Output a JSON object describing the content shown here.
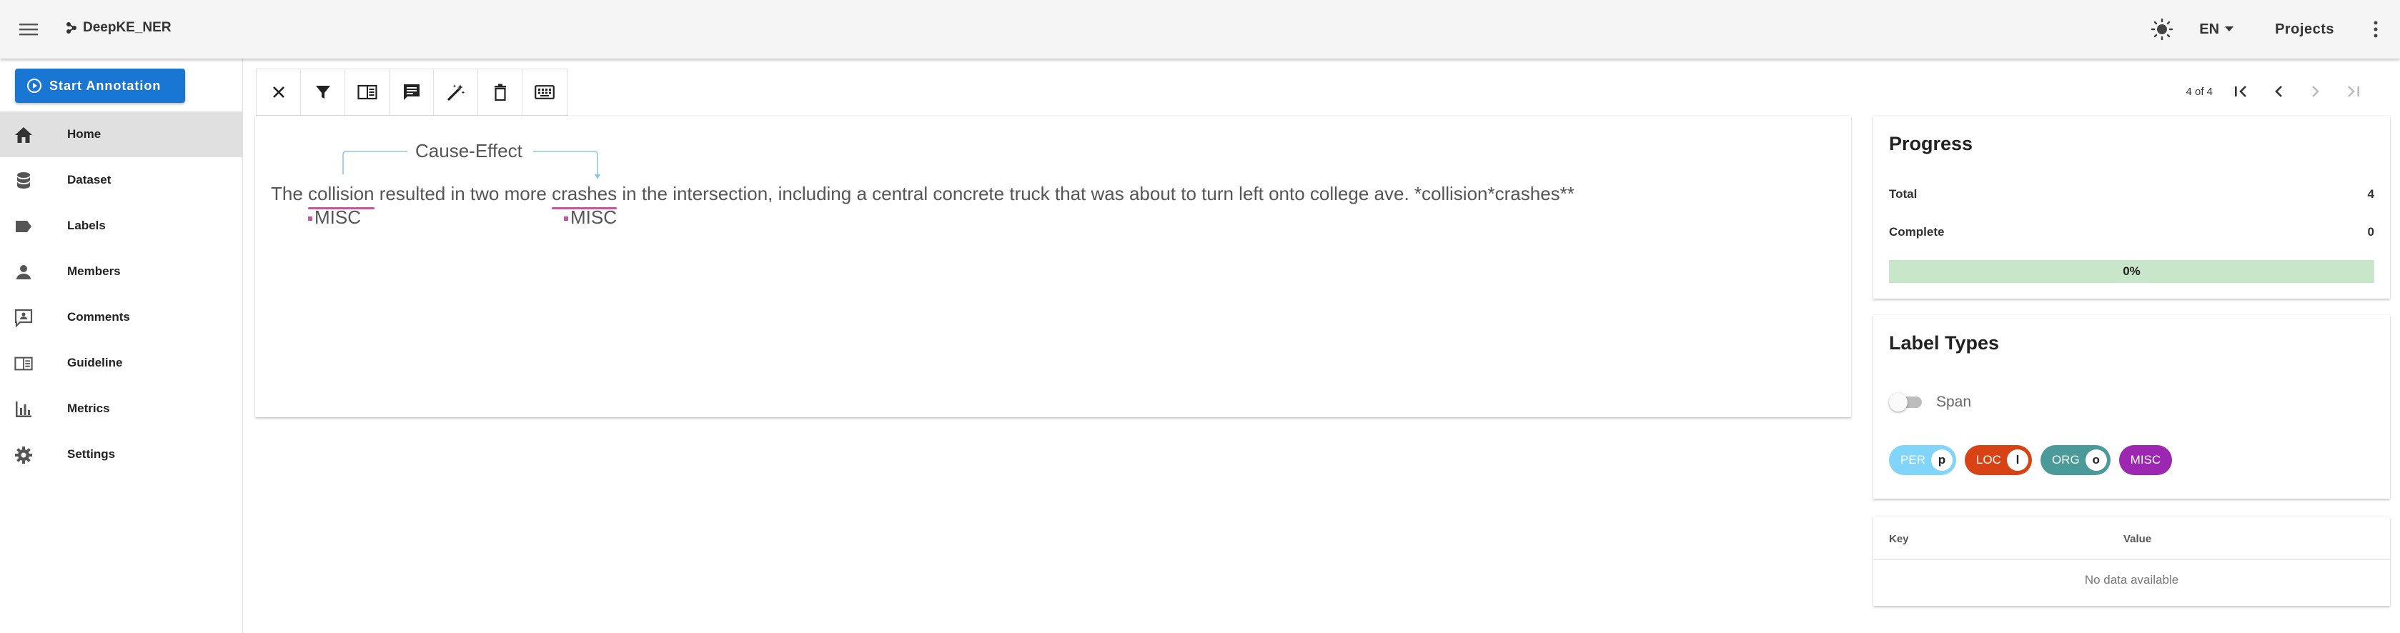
{
  "app": {
    "title": "DeepKE_NER",
    "language": "EN",
    "projects_label": "Projects"
  },
  "sidebar": {
    "start_button": "Start Annotation",
    "items": [
      {
        "label": "Home",
        "icon": "home-icon",
        "active": true
      },
      {
        "label": "Dataset",
        "icon": "database-icon",
        "active": false
      },
      {
        "label": "Labels",
        "icon": "label-icon",
        "active": false
      },
      {
        "label": "Members",
        "icon": "person-icon",
        "active": false
      },
      {
        "label": "Comments",
        "icon": "comment-icon",
        "active": false
      },
      {
        "label": "Guideline",
        "icon": "book-icon",
        "active": false
      },
      {
        "label": "Metrics",
        "icon": "bar-chart-icon",
        "active": false
      },
      {
        "label": "Settings",
        "icon": "gear-icon",
        "active": false
      }
    ]
  },
  "toolbar": {
    "tools": [
      "close-icon",
      "filter-icon",
      "guideline-icon",
      "comment-icon",
      "auto-label-icon",
      "delete-icon",
      "keyboard-icon"
    ],
    "page_text": "4 of 4"
  },
  "annotation": {
    "text_before": "The ",
    "span1": "collision",
    "text_mid": " resulted in two more ",
    "span2": "crashes",
    "text_after": " in the intersection, including a central concrete truck that was about to turn left onto college ave. *collision*crashes**",
    "span1_label": "MISC",
    "span2_label": "MISC",
    "relation": "Cause-Effect",
    "span_color": "#c2579f"
  },
  "progress": {
    "title": "Progress",
    "total_label": "Total",
    "total_value": "4",
    "complete_label": "Complete",
    "complete_value": "0",
    "bar_text": "0%",
    "fraction": 0
  },
  "label_types": {
    "title": "Label Types",
    "switch_label": "Span",
    "labels": [
      {
        "name": "PER",
        "key": "p",
        "color": "#81d4fa"
      },
      {
        "name": "LOC",
        "key": "l",
        "color": "#d84315"
      },
      {
        "name": "ORG",
        "key": "o",
        "color": "#4a9a9a"
      },
      {
        "name": "MISC",
        "key": "",
        "color": "#9c27b0"
      }
    ]
  },
  "metadata": {
    "key_header": "Key",
    "value_header": "Value",
    "empty_text": "No data available"
  }
}
